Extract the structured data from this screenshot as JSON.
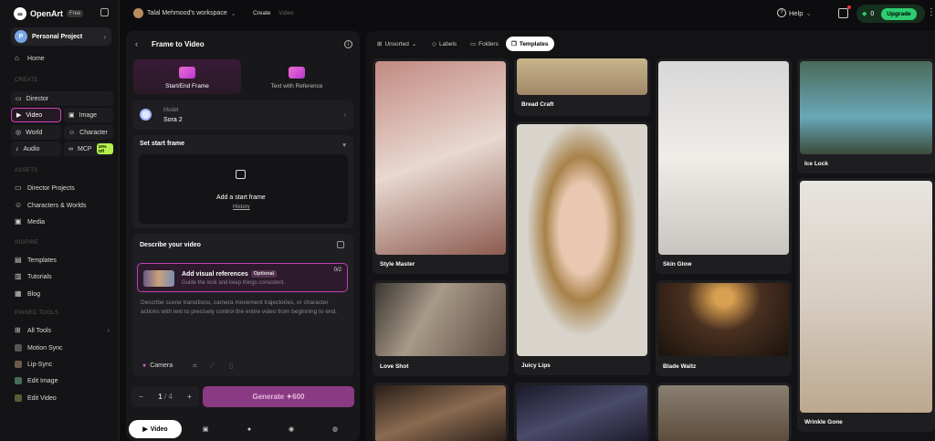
{
  "brand": {
    "name": "OpenArt",
    "plan": "Free"
  },
  "project": {
    "initial": "P",
    "label": "Personal Project"
  },
  "sidebar": {
    "home": "Home",
    "create_label": "CREATE",
    "create_tiles": [
      {
        "label": "Director"
      },
      {
        "label": "Video"
      },
      {
        "label": "Image"
      },
      {
        "label": "World"
      },
      {
        "label": "Character"
      },
      {
        "label": "Audio"
      },
      {
        "label": "MCP",
        "badge": "10% Off"
      }
    ],
    "assets_label": "ASSETS",
    "assets": [
      "Director Projects",
      "Characters & Worlds",
      "Media"
    ],
    "inspire_label": "INSPIRE",
    "inspire": [
      "Templates",
      "Tutorials",
      "Blog"
    ],
    "pinned_label": "PINNED TOOLS",
    "pinned": [
      "All Tools",
      "Motion Sync",
      "Lip-Sync",
      "Edit Image",
      "Edit Video"
    ]
  },
  "topbar": {
    "workspace": "Talal Mehmood's workspace",
    "crumb_create": "Create",
    "crumb_video": "Video",
    "help": "Help",
    "credits": "0",
    "upgrade": "Upgrade"
  },
  "panel": {
    "title": "Frame to Video",
    "modes": [
      "Start/End Frame",
      "Text with Reference"
    ],
    "model_label": "Model",
    "model_value": "Sora 2",
    "start_frame": "Set start frame",
    "add_start": "Add a start frame",
    "history": "History",
    "describe": "Describe your video",
    "ref_title": "Add visual references",
    "ref_optional": "Optional",
    "ref_sub": "Guide the look and keep things consistent.",
    "ref_count": "0/2",
    "prompt_placeholder": "Describe scene transitions, camera movement trajectories, or character actions with text to precisely control the entire video from beginning to end.",
    "camera": "Camera",
    "count": "1",
    "count_total": "/ 4",
    "generate": "Generate",
    "cost": "600",
    "tab_video": "Video"
  },
  "gallery": {
    "filters": [
      "Unsorted",
      "Labels",
      "Folders",
      "Templates"
    ],
    "cards": [
      "Bread Craft",
      "Style Master",
      "Love Shot",
      "Juicy Lips",
      "Skin Glow",
      "Blade Waltz",
      "Ice Lock",
      "Wrinkle Gone"
    ]
  }
}
